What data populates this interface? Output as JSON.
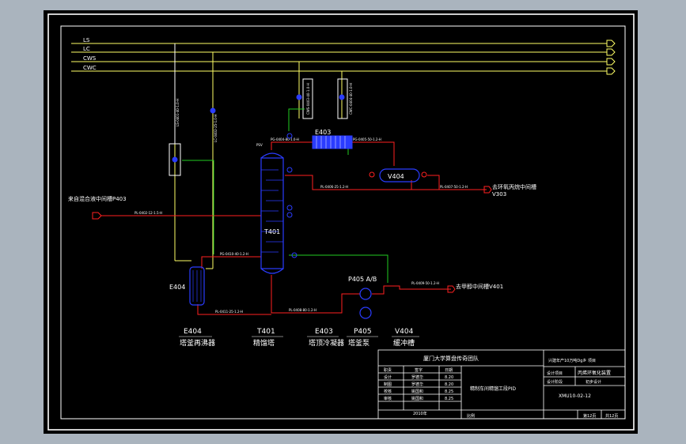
{
  "colors": {
    "canvas": "#000000",
    "frame": "#ffffff",
    "utility_line": "#ffff66",
    "process_red": "#ff2020",
    "process_green": "#22cc22",
    "equipment_blue": "#2a3cff",
    "text": "#ffffff"
  },
  "utilities": [
    "LS",
    "LC",
    "CWS",
    "CWC"
  ],
  "streams": {
    "feed_in": "来自混合液中间槽P403",
    "to_v303": "去环氧丙烷中间槽",
    "to_v303_tag": "V303",
    "to_v401": "去甲醇中间槽V401"
  },
  "line_tags": {
    "feed": "PL-0402-12-1.5-H",
    "overhead": "PG-0404-80-1.0-H",
    "cond_out": "PG-0405-50-1.2-H",
    "reflux": "PL-0406-25-1.2-H",
    "product": "PL-0407-50-1.2-H",
    "pump_out": "PL-0409-50-1.2-H",
    "bottoms": "PL-0408-80-1.2-H",
    "reboiler_ret": "PG-0410-40-1.2-H",
    "reboiler_in": "PL-0411-25-1.2-H",
    "steam": "LS-0401-40-1.0-H",
    "condensate": "LC-0402-25-1.0-H",
    "cw_supply": "CWS-0403-40-1.0-H",
    "cw_return": "CWC-0404-40-1.0-H"
  },
  "equipment_tags": {
    "condenser": "E403",
    "drum": "V404",
    "column": "T401",
    "reboiler": "E404",
    "pump": "P405 A/B",
    "psv": "PSV"
  },
  "legend": [
    {
      "tag": "E404",
      "name": "塔釜再沸器"
    },
    {
      "tag": "T401",
      "name": "精馏塔"
    },
    {
      "tag": "E403",
      "name": "塔顶冷凝器"
    },
    {
      "tag": "P405",
      "name": "塔釜泵"
    },
    {
      "tag": "V404",
      "name": "缓冲槽"
    }
  ],
  "title_block": {
    "org": "厦门大学算盘传奇团队",
    "project": "兴建年产10万吨Dg乡 项目",
    "project_label": "设计项目",
    "project_value": "丙烯环氧化装置",
    "stage_label": "设计阶段",
    "stage_value": "初步设计",
    "drawing_title": "精制车间精馏工段PID",
    "drawing_no": "XMU10-02-12",
    "page": "第12页",
    "total": "共12页",
    "scale_label": "比例",
    "header": [
      "职责",
      "签字",
      "日期"
    ],
    "rows": [
      [
        "设计",
        "罗德华",
        "8.20"
      ],
      [
        "制图",
        "罗德华",
        "8.20"
      ],
      [
        "校核",
        "姚国和",
        "8.25"
      ],
      [
        "审核",
        "姚国和",
        "8.25"
      ]
    ],
    "year": "2010年"
  }
}
